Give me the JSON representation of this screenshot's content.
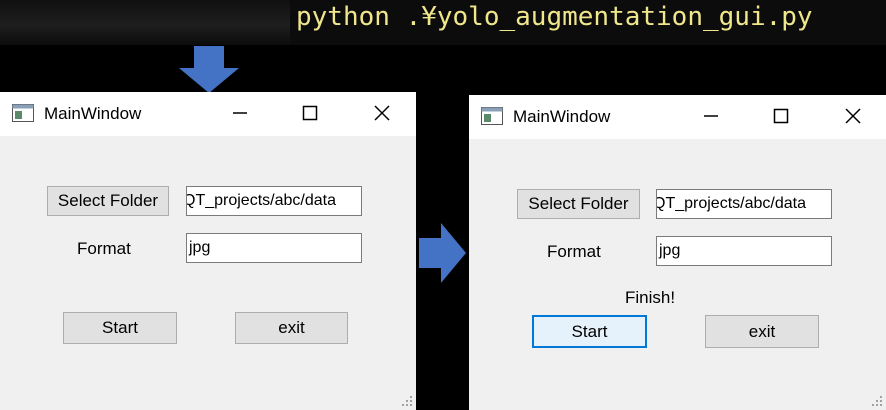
{
  "terminal": {
    "command": "python .¥yolo_augmentation_gui.py"
  },
  "windows": [
    {
      "title": "MainWindow",
      "select_folder_label": "Select Folder",
      "folder_value": "QT_projects/abc/data",
      "format_label": "Format",
      "format_value": "jpg",
      "status_text": "",
      "start_label": "Start",
      "exit_label": "exit"
    },
    {
      "title": "MainWindow",
      "select_folder_label": "Select Folder",
      "folder_value": "QT_projects/abc/data",
      "format_label": "Format",
      "format_value": "jpg",
      "status_text": "Finish!",
      "start_label": "Start",
      "exit_label": "exit"
    }
  ],
  "colors": {
    "arrow": "#4472c4",
    "terminal_text": "#f0e68c",
    "window_bg": "#f0f0f0",
    "focus_border": "#0078d7"
  }
}
